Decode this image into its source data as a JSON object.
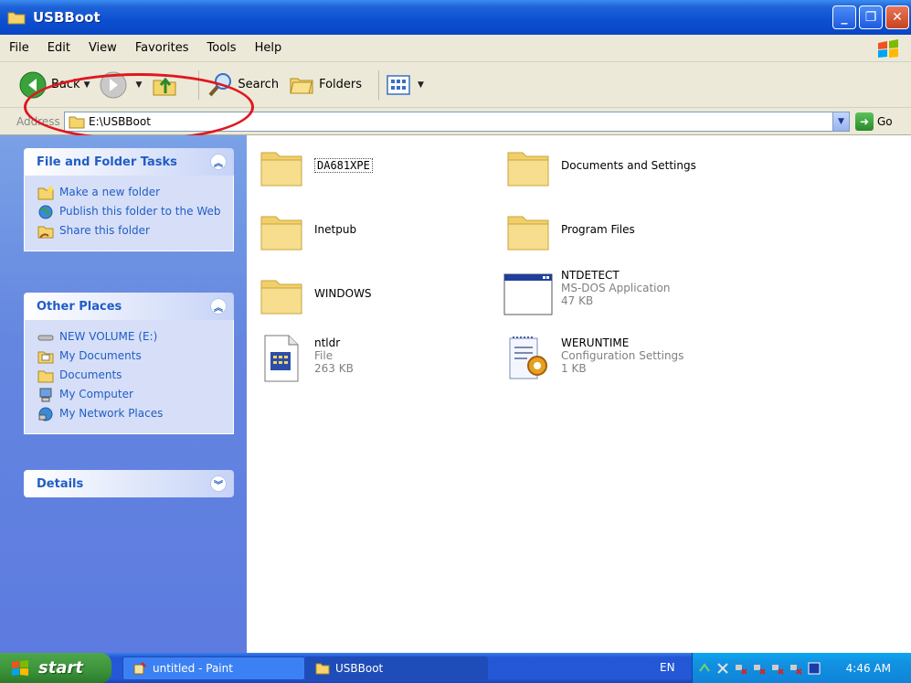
{
  "window": {
    "title": "USBBoot"
  },
  "menu": [
    "File",
    "Edit",
    "View",
    "Favorites",
    "Tools",
    "Help"
  ],
  "toolbar": {
    "back": "Back",
    "search": "Search",
    "folders": "Folders"
  },
  "address": {
    "label": "Address",
    "value": "E:\\USBBoot",
    "go": "Go"
  },
  "tasks_panel": {
    "title": "File and Folder Tasks",
    "links": [
      "Make a new folder",
      "Publish this folder to the Web",
      "Share this folder"
    ]
  },
  "places_panel": {
    "title": "Other Places",
    "links": [
      "NEW VOLUME (E:)",
      "My Documents",
      "Documents",
      "My Computer",
      "My Network Places"
    ]
  },
  "details_panel": {
    "title": "Details"
  },
  "files": [
    {
      "name": "DA681XPE"
    },
    {
      "name": "Documents and Settings"
    },
    {
      "name": "Inetpub"
    },
    {
      "name": "Program Files"
    },
    {
      "name": "WINDOWS"
    },
    {
      "name": "NTDETECT",
      "type": "MS-DOS Application",
      "size": "47 KB"
    },
    {
      "name": "ntldr",
      "type": "File",
      "size": "263 KB"
    },
    {
      "name": "WERUNTIME",
      "type": "Configuration Settings",
      "size": "1 KB"
    }
  ],
  "taskbar": {
    "start": "start",
    "tasks": [
      "untitled - Paint",
      "USBBoot"
    ],
    "lang": "EN",
    "clock": "4:46 AM"
  }
}
